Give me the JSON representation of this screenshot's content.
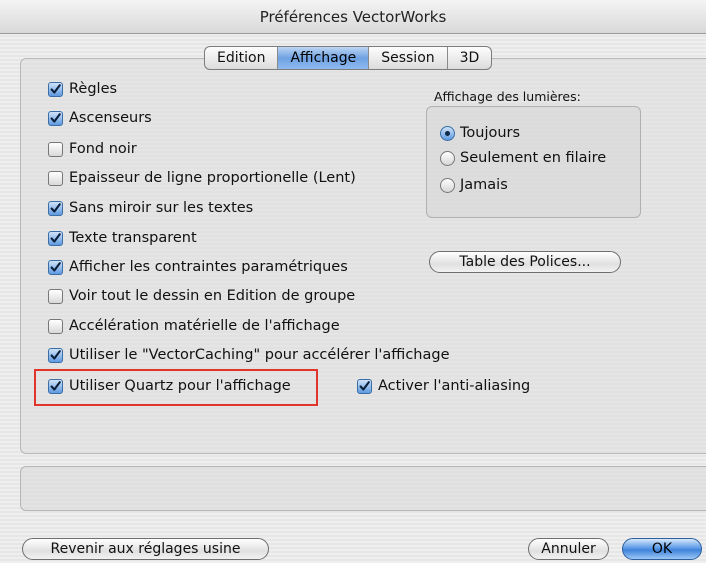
{
  "window": {
    "title": "Préférences VectorWorks"
  },
  "tabs": [
    {
      "label": "Edition",
      "active": false
    },
    {
      "label": "Affichage",
      "active": true
    },
    {
      "label": "Session",
      "active": false
    },
    {
      "label": "3D",
      "active": false
    }
  ],
  "options": [
    {
      "label": "Règles",
      "checked": true
    },
    {
      "label": "Ascenseurs",
      "checked": true
    },
    {
      "label": "Fond noir",
      "checked": false
    },
    {
      "label": "Epaisseur de ligne proportionelle (Lent)",
      "checked": false
    },
    {
      "label": "Sans miroir sur les textes",
      "checked": true
    },
    {
      "label": "Texte transparent",
      "checked": true
    },
    {
      "label": "Afficher les contraintes paramétriques",
      "checked": true
    },
    {
      "label": "Voir tout le dessin en Edition de groupe",
      "checked": false
    },
    {
      "label": "Accélération matérielle de l'affichage",
      "checked": false
    },
    {
      "label": "Utiliser le \"VectorCaching\" pour accélérer l'affichage",
      "checked": true
    },
    {
      "label": "Utiliser Quartz pour l'affichage",
      "checked": true,
      "highlighted": true
    }
  ],
  "antialiasing": {
    "label": "Activer l'anti-aliasing",
    "checked": true
  },
  "lights": {
    "title": "Affichage des lumières:",
    "options": [
      {
        "label": "Toujours",
        "selected": true
      },
      {
        "label": "Seulement en filaire",
        "selected": false
      },
      {
        "label": "Jamais",
        "selected": false
      }
    ]
  },
  "buttons": {
    "fonts_table": "Table des Polices...",
    "reset": "Revenir aux réglages usine",
    "cancel": "Annuler",
    "ok": "OK"
  },
  "colors": {
    "accent": "#5b9ae6",
    "highlight_box": "#e0352b"
  },
  "icons": {
    "checkbox_checked": "checkmark-icon",
    "radio_selected": "radio-dot-icon"
  }
}
